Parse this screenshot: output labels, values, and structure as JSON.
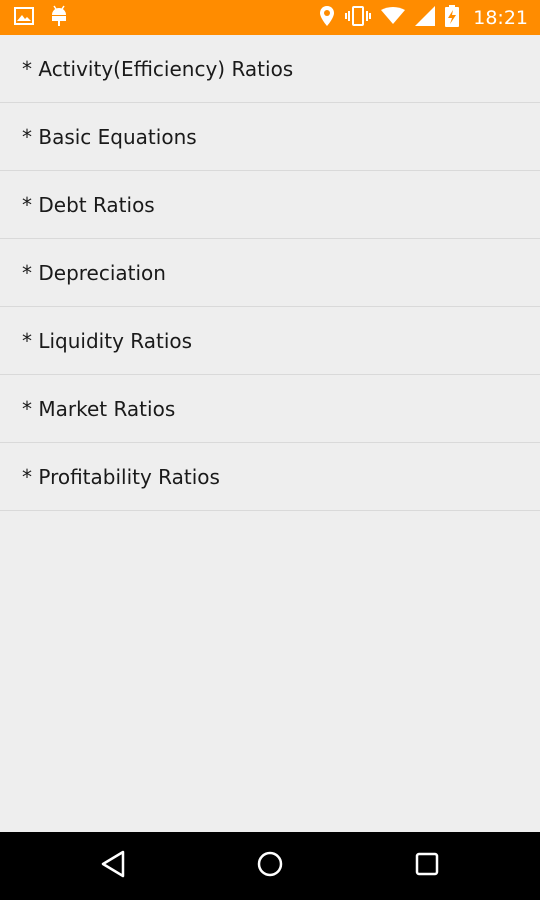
{
  "status_bar": {
    "time": "18:21",
    "background_color": "#ff8c00",
    "left_icons": [
      "image-icon",
      "android-debug-icon"
    ],
    "right_icons": [
      "location-icon",
      "vibrate-icon",
      "wifi-icon",
      "signal-icon",
      "battery-charging-icon"
    ]
  },
  "list": {
    "items": [
      {
        "label": "* Activity(Efficiency) Ratios"
      },
      {
        "label": "* Basic Equations"
      },
      {
        "label": "* Debt Ratios"
      },
      {
        "label": "* Depreciation"
      },
      {
        "label": "* Liquidity Ratios"
      },
      {
        "label": "* Market Ratios"
      },
      {
        "label": "* Profitability Ratios"
      }
    ]
  },
  "nav_bar": {
    "buttons": [
      "back-icon",
      "home-icon",
      "recents-icon"
    ]
  }
}
